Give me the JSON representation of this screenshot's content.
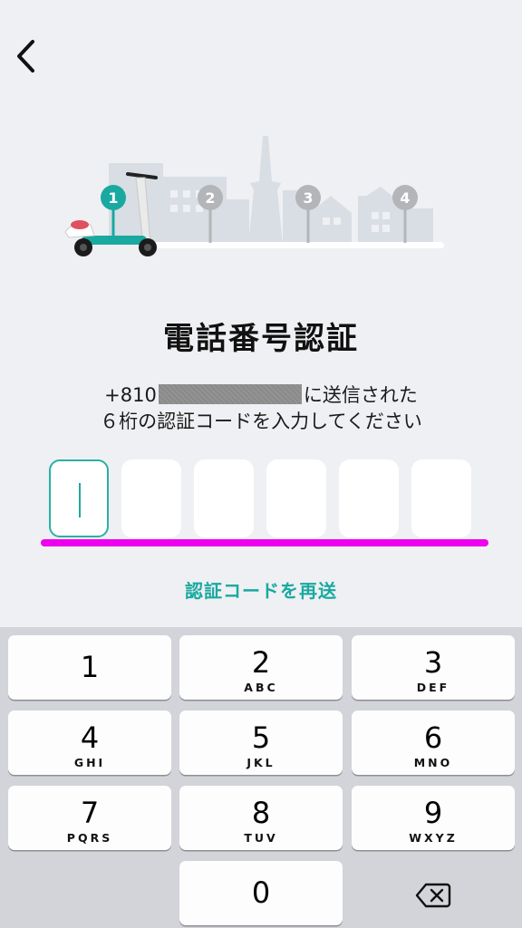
{
  "nav": {
    "back_icon": "chevron-left-icon"
  },
  "progress": {
    "steps": [
      "1",
      "2",
      "3",
      "4"
    ],
    "current_step": 1,
    "colors": {
      "active": "#1aa9a0",
      "inactive": "#b3b5b9",
      "skyline": "#d8dde3",
      "track": "#ffffff"
    }
  },
  "header": {
    "title": "電話番号認証"
  },
  "instructions": {
    "phone_prefix": "+810",
    "suffix_line1": "に送信された",
    "line2": "６桁の認証コードを入力してください"
  },
  "code_input": {
    "length": 6,
    "values": [
      "",
      "",
      "",
      "",
      "",
      ""
    ],
    "focused_index": 0
  },
  "resend_label": "認証コードを再送",
  "keypad": {
    "keys": [
      {
        "digit": "1",
        "letters": ""
      },
      {
        "digit": "2",
        "letters": "ABC"
      },
      {
        "digit": "3",
        "letters": "DEF"
      },
      {
        "digit": "4",
        "letters": "GHI"
      },
      {
        "digit": "5",
        "letters": "JKL"
      },
      {
        "digit": "6",
        "letters": "MNO"
      },
      {
        "digit": "7",
        "letters": "PQRS"
      },
      {
        "digit": "8",
        "letters": "TUV"
      },
      {
        "digit": "9",
        "letters": "WXYZ"
      },
      {
        "digit": "0",
        "letters": ""
      }
    ],
    "delete_icon": "backspace-icon"
  },
  "colors": {
    "accent": "#1aa9a0",
    "highlight": "#ee00ee",
    "background": "#eff0f3"
  }
}
